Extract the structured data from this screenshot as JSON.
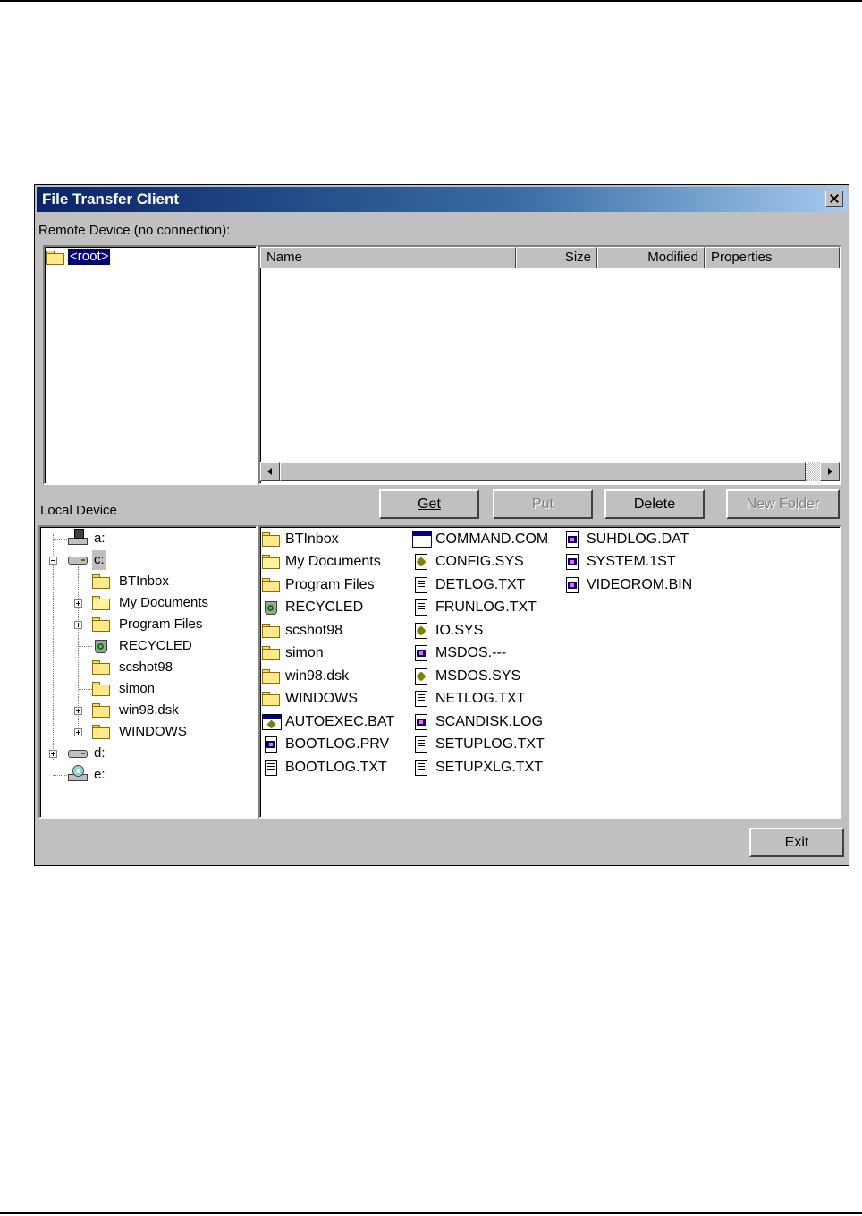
{
  "window": {
    "title": "File Transfer Client"
  },
  "remote": {
    "label": "Remote Device (no connection):",
    "tree_root": "<root>",
    "columns": [
      "Name",
      "Size",
      "Modified",
      "Properties"
    ]
  },
  "local": {
    "label": "Local Device"
  },
  "buttons": {
    "get": "Get",
    "put": "Put",
    "delete": "Delete",
    "new_folder": "New Folder",
    "exit": "Exit"
  },
  "local_tree": [
    {
      "label": "a:",
      "icon": "floppy-drive-icon"
    },
    {
      "label": "c:",
      "icon": "hard-drive-icon"
    },
    {
      "label": "BTInbox",
      "icon": "folder-icon"
    },
    {
      "label": "My Documents",
      "icon": "my-documents-folder-icon"
    },
    {
      "label": "Program Files",
      "icon": "folder-icon"
    },
    {
      "label": "RECYCLED",
      "icon": "recycle-bin-icon"
    },
    {
      "label": "scshot98",
      "icon": "folder-icon"
    },
    {
      "label": "simon",
      "icon": "folder-icon"
    },
    {
      "label": "win98.dsk",
      "icon": "folder-icon"
    },
    {
      "label": "WINDOWS",
      "icon": "folder-icon"
    },
    {
      "label": "d:",
      "icon": "hard-drive-icon"
    },
    {
      "label": "e:",
      "icon": "cd-drive-icon"
    }
  ],
  "local_files": [
    {
      "name": "BTInbox",
      "icon": "folder-icon"
    },
    {
      "name": "My Documents",
      "icon": "my-documents-folder-icon"
    },
    {
      "name": "Program Files",
      "icon": "folder-icon"
    },
    {
      "name": "RECYCLED",
      "icon": "recycle-bin-icon"
    },
    {
      "name": "scshot98",
      "icon": "folder-icon"
    },
    {
      "name": "simon",
      "icon": "folder-icon"
    },
    {
      "name": "win98.dsk",
      "icon": "folder-icon"
    },
    {
      "name": "WINDOWS",
      "icon": "folder-icon"
    },
    {
      "name": "AUTOEXEC.BAT",
      "icon": "batch-file-icon"
    },
    {
      "name": "BOOTLOG.PRV",
      "icon": "system-file-icon"
    },
    {
      "name": "BOOTLOG.TXT",
      "icon": "text-file-icon"
    },
    {
      "name": "COMMAND.COM",
      "icon": "program-icon"
    },
    {
      "name": "CONFIG.SYS",
      "icon": "config-file-icon"
    },
    {
      "name": "DETLOG.TXT",
      "icon": "text-file-icon"
    },
    {
      "name": "FRUNLOG.TXT",
      "icon": "text-file-icon"
    },
    {
      "name": "IO.SYS",
      "icon": "config-file-icon"
    },
    {
      "name": "MSDOS.---",
      "icon": "system-file-icon"
    },
    {
      "name": "MSDOS.SYS",
      "icon": "config-file-icon"
    },
    {
      "name": "NETLOG.TXT",
      "icon": "text-file-icon"
    },
    {
      "name": "SCANDISK.LOG",
      "icon": "system-file-icon"
    },
    {
      "name": "SETUPLOG.TXT",
      "icon": "text-file-icon"
    },
    {
      "name": "SETUPXLG.TXT",
      "icon": "text-file-icon"
    },
    {
      "name": "SUHDLOG.DAT",
      "icon": "system-file-icon"
    },
    {
      "name": "SYSTEM.1ST",
      "icon": "system-file-icon"
    },
    {
      "name": "VIDEOROM.BIN",
      "icon": "system-file-icon"
    }
  ]
}
